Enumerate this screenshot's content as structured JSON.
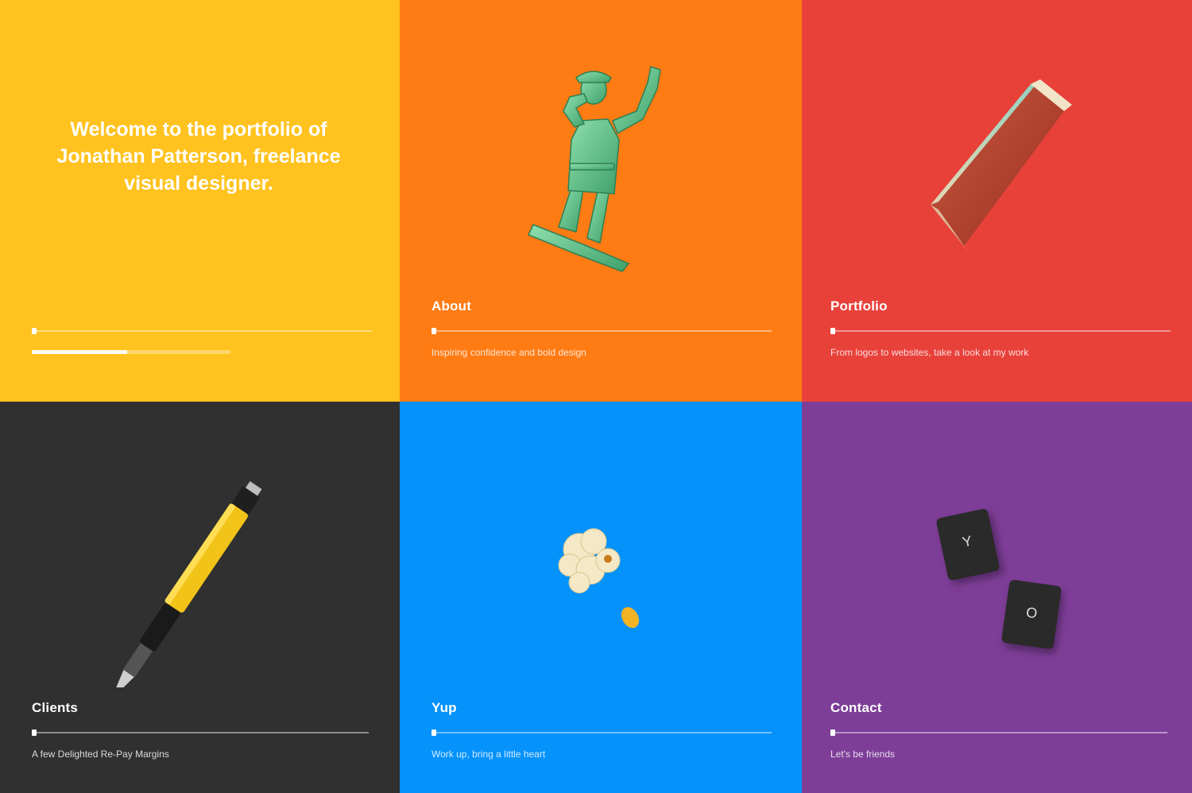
{
  "welcome": {
    "text": "Welcome to the portfolio of Jonathan Patterson, freelance visual designer."
  },
  "progress": {
    "value": 0.48
  },
  "tiles": [
    {
      "label": "",
      "description": "",
      "color": "#FFC21E"
    },
    {
      "label": "About",
      "description": "Inspiring confidence and bold design",
      "color": "#FF7B14"
    },
    {
      "label": "Portfolio",
      "description": "From logos to websites, take a look at my work",
      "color": "#E8413A"
    },
    {
      "label": "Clients",
      "description": "A few Delighted Re-Pay Margins",
      "color": "#303030"
    },
    {
      "label": "Yup",
      "description": "Work up, bring a little heart",
      "color": "#0592FB"
    },
    {
      "label": "Contact",
      "description": "Let's be friends",
      "color": "#7E3E98"
    }
  ],
  "keys": [
    "Y",
    "O"
  ]
}
